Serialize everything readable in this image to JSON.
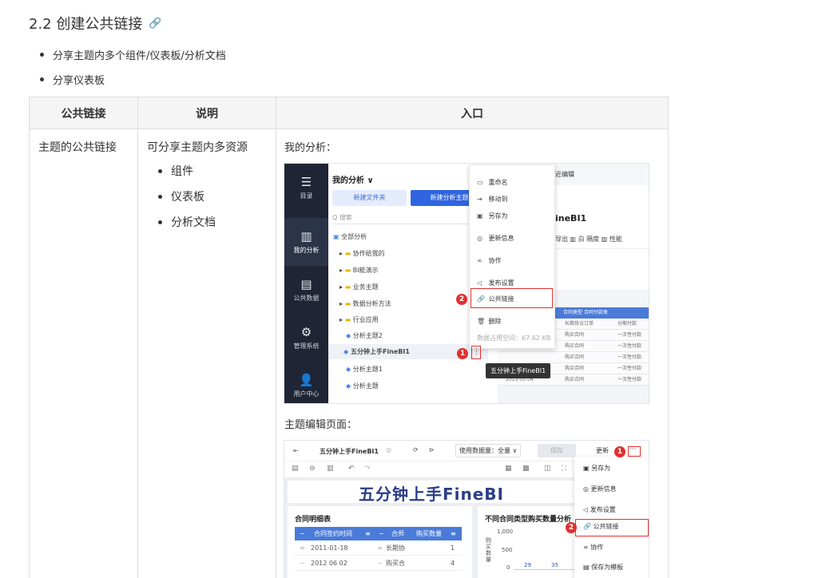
{
  "heading": "2.2 创建公共链接",
  "heading_icon": "link-icon",
  "bullets": [
    "分享主题内多个组件/仪表板/分析文档",
    "分享仪表板"
  ],
  "table": {
    "headers": [
      "公共链接",
      "说明",
      "入口"
    ],
    "row": {
      "type": "主题的公共链接",
      "desc": "可分享主题内多资源",
      "items": [
        "组件",
        "仪表板",
        "分析文档"
      ],
      "caption1": "我的分析：",
      "caption2": "主题编辑页面："
    }
  },
  "shot1": {
    "nav": [
      {
        "icon": "☰",
        "label": "目录"
      },
      {
        "icon": "▥",
        "label": "我的分析"
      },
      {
        "icon": "▤",
        "label": "公共数据"
      },
      {
        "icon": "⚙",
        "label": "管理系统"
      },
      {
        "icon": "👤",
        "label": "用户中心"
      }
    ],
    "panel_title": "我的分析 ∨",
    "new_folder": "新建文件夹",
    "new_subject": "新建分析主题",
    "search_placeholder": "Q  搜索",
    "all": "全部分析",
    "tree": [
      "协作给我的",
      "BI能演示",
      "业务主题",
      "数据分析方法",
      "行业应用"
    ],
    "subjects": [
      "分析主题2",
      "五分钟上手FineBI1",
      "分析主题1",
      "分析主题"
    ],
    "menu": [
      "重命名",
      "移动到",
      "另存为",
      "更新信息",
      "协作",
      "发布设置",
      "公共链接",
      "删除"
    ],
    "menu_icons": [
      "▭",
      "⇥",
      "▣",
      "◎",
      "∞",
      "◁",
      "🔗",
      "🗑"
    ],
    "usage": "数据占用空间：67.62 KB",
    "tooltip": "五分钟上手FineBI1",
    "badge1": "1",
    "badge2": "2",
    "right_edit": "近编辑",
    "right_name": "ineBI1",
    "right_tools": "导出   ▥ 白 隔度   ▥ 性能",
    "table_head": "合同类型        合同付款类",
    "rows": [
      [
        "",
        "长期协议订单",
        "分期付款"
      ],
      [
        "",
        "购买合同",
        "一次性付款"
      ],
      [
        "2013-01-02",
        "购买合同",
        "一次性付款"
      ],
      [
        "",
        "购买合同",
        "一次性付款"
      ],
      [
        "2013-02-18",
        "购买合同",
        "一次性付款"
      ],
      [
        "2013-03-04",
        "购买合同",
        "一次性付款"
      ]
    ]
  },
  "shot2": {
    "title": "五分钟上手FineBI1",
    "usage": "使用数据量：全量 ∨",
    "save": "保存",
    "update": "更新",
    "more": "···",
    "banner": "五分钟上手FineBI",
    "card1_title": "合同明细表",
    "card1_head": [
      "合同签约时间",
      "合师",
      "购买数量"
    ],
    "card1_rows": [
      [
        "2011-01-18",
        "长期协",
        "1"
      ],
      [
        "2012 06 02",
        "购买合",
        "4"
      ]
    ],
    "card2_title": "不同合同类型购买数量分析",
    "axis_ticks": [
      "1,000",
      "500",
      "0"
    ],
    "axis_label": "购买数量",
    "bar_vals": [
      "29",
      "35"
    ],
    "menu": [
      "另存为",
      "更新信息",
      "发布设置",
      "公共链接",
      "协作",
      "保存为模板"
    ],
    "menu_icons": [
      "▣",
      "◎",
      "◁",
      "🔗",
      "∞",
      "▤"
    ],
    "badge1": "1",
    "badge2": "2"
  }
}
